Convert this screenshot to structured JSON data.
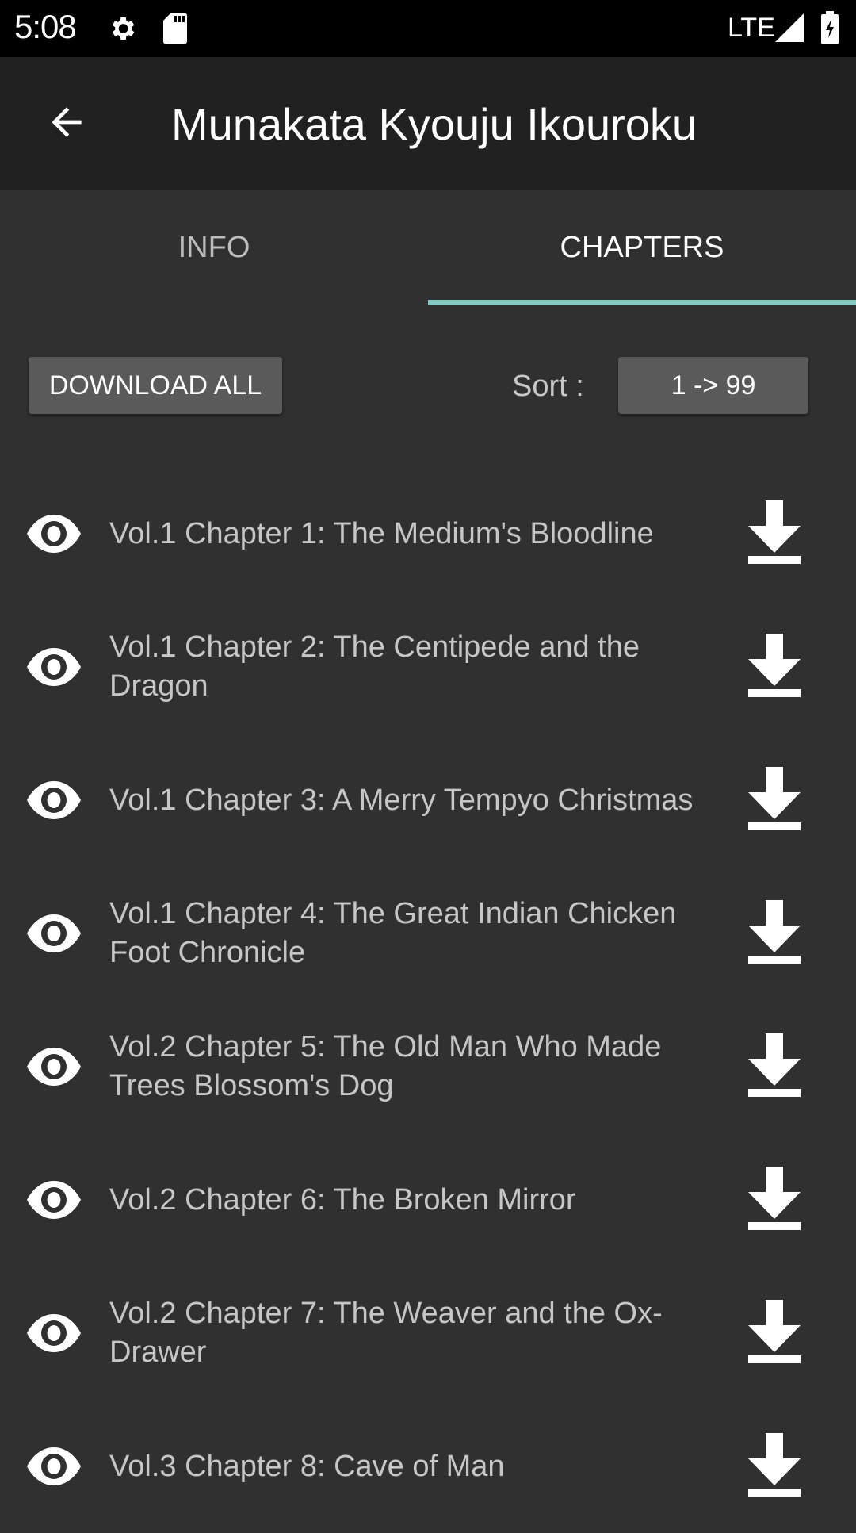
{
  "status_bar": {
    "time": "5:08",
    "network": "LTE",
    "icons": [
      "settings-icon",
      "sd-card-icon",
      "signal-icon",
      "battery-charging-icon"
    ]
  },
  "toolbar": {
    "back_icon": "arrow-back-icon",
    "title": "Munakata Kyouju Ikouroku"
  },
  "tabs": [
    {
      "label": "INFO",
      "selected": false
    },
    {
      "label": "CHAPTERS",
      "selected": true
    }
  ],
  "colors": {
    "accent": "#80cbc4",
    "background": "#303030",
    "toolbar": "#212121",
    "button": "#5a5a5a"
  },
  "actions": {
    "download_all_label": "DOWNLOAD ALL",
    "sort_label": "Sort :",
    "sort_value": "1 -> 99"
  },
  "chapters": [
    {
      "title": "Vol.1 Chapter 1: The Medium's Bloodline",
      "view_icon": "eye-icon",
      "download_icon": "download-icon"
    },
    {
      "title": "Vol.1 Chapter 2: The Centipede and the Dragon",
      "view_icon": "eye-icon",
      "download_icon": "download-icon"
    },
    {
      "title": "Vol.1 Chapter 3: A Merry Tempyo Christmas",
      "view_icon": "eye-icon",
      "download_icon": "download-icon"
    },
    {
      "title": "Vol.1 Chapter 4: The Great Indian Chicken Foot Chronicle",
      "view_icon": "eye-icon",
      "download_icon": "download-icon"
    },
    {
      "title": "Vol.2 Chapter 5: The Old Man Who Made Trees Blossom's Dog",
      "view_icon": "eye-icon",
      "download_icon": "download-icon"
    },
    {
      "title": "Vol.2 Chapter 6: The Broken Mirror",
      "view_icon": "eye-icon",
      "download_icon": "download-icon"
    },
    {
      "title": "Vol.2 Chapter 7: The Weaver and the Ox-Drawer",
      "view_icon": "eye-icon",
      "download_icon": "download-icon"
    },
    {
      "title": "Vol.3 Chapter 8: Cave of Man",
      "view_icon": "eye-icon",
      "download_icon": "download-icon"
    }
  ]
}
